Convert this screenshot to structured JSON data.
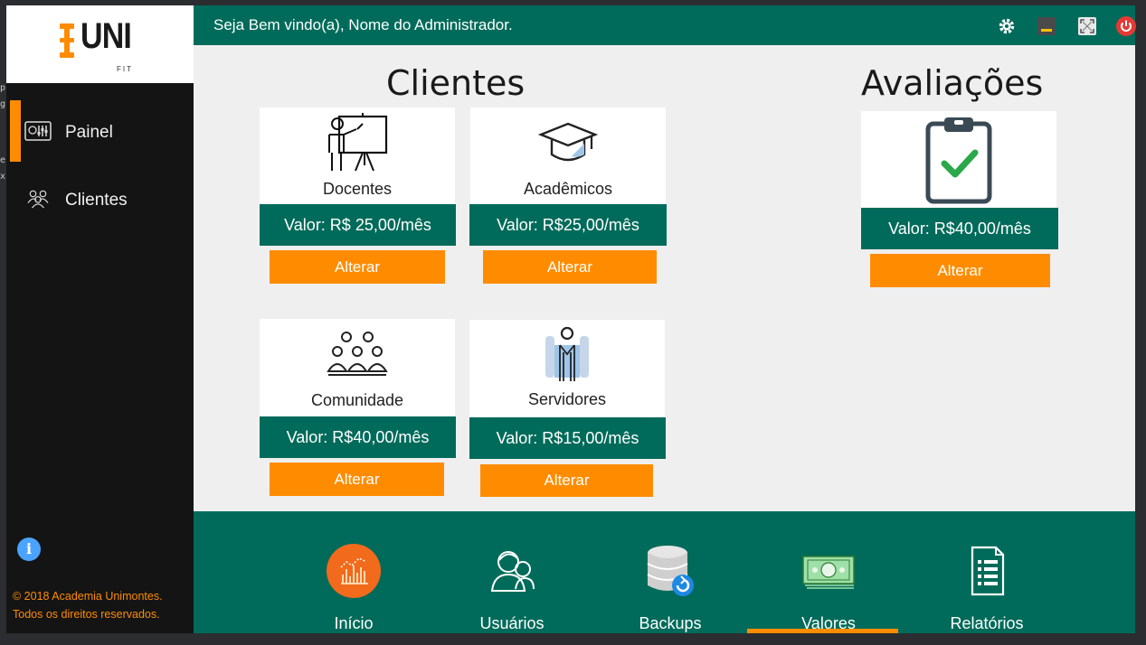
{
  "header": {
    "welcome": "Seja Bem vindo(a), Nome do Administrador."
  },
  "topbar_icons": [
    "gear-icon",
    "minimize-icon",
    "fullscreen-icon",
    "power-icon"
  ],
  "logo": {
    "text": "UNI",
    "sub": "FIT"
  },
  "sidebar": {
    "items": [
      {
        "label": "Painel",
        "icon": "dashboard-icon",
        "active": true
      },
      {
        "label": "Clientes",
        "icon": "users-icon",
        "active": false
      }
    ],
    "copyright_line1": "© 2018 Academia Unimontes.",
    "copyright_line2": "Todos os direitos reservados."
  },
  "sections": {
    "clientes_title": "Clientes",
    "avaliacoes_title": "Avaliações"
  },
  "cards": [
    {
      "label": "Docentes",
      "price": "Valor: R$ 25,00/mês",
      "button": "Alterar",
      "icon": "teacher-icon"
    },
    {
      "label": "Acadêmicos",
      "price": "Valor: R$25,00/mês",
      "button": "Alterar",
      "icon": "graduation-cap-icon"
    },
    {
      "label": "Comunidade",
      "price": "Valor: R$40,00/mês",
      "button": "Alterar",
      "icon": "community-icon"
    },
    {
      "label": "Servidores",
      "price": "Valor: R$15,00/mês",
      "button": "Alterar",
      "icon": "employee-icon"
    }
  ],
  "avaliacao": {
    "price": "Valor: R$40,00/mês",
    "button": "Alterar",
    "icon": "clipboard-check-icon"
  },
  "bottom_nav": [
    {
      "label": "Início",
      "icon": "chart-icon"
    },
    {
      "label": "Usuários",
      "icon": "users-icon"
    },
    {
      "label": "Backups",
      "icon": "database-icon"
    },
    {
      "label": "Valores",
      "icon": "money-icon",
      "active": true
    },
    {
      "label": "Relatórios",
      "icon": "report-icon"
    }
  ],
  "colors": {
    "primary": "#006b5a",
    "accent": "#ff8c00",
    "sidebar": "#141414"
  }
}
